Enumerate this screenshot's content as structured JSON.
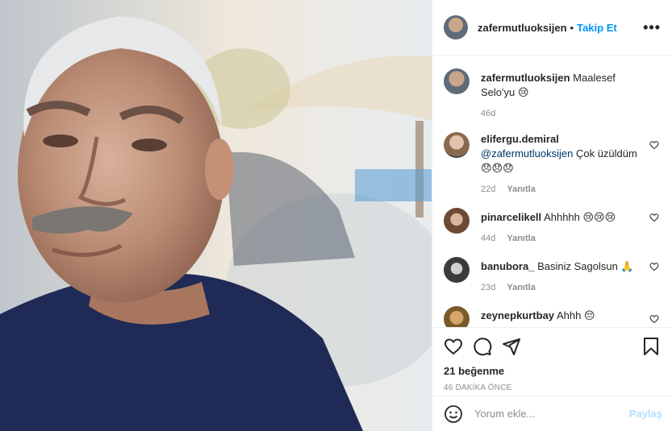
{
  "post": {
    "author": "zafermutluoksijen",
    "separator": "•",
    "follow_label": "Takip Et",
    "more_label": "•••",
    "caption": "Maalesef Selo'yu 😢",
    "caption_age": "46d"
  },
  "comments": [
    {
      "user": "elifergu.demiral",
      "mention": "@zafermutluoksijen",
      "text": " Çok üzüldüm 😞😞😞",
      "age": "22d",
      "reply_label": "Yanıtla"
    },
    {
      "user": "pinarcelikell",
      "mention": "",
      "text": "Ahhhhh 😢😢😢",
      "age": "44d",
      "reply_label": "Yanıtla"
    },
    {
      "user": "banubora_",
      "mention": "",
      "text": "Basiniz Sagolsun 🙏",
      "age": "23d",
      "reply_label": "Yanıtla"
    },
    {
      "user": "zeynepkurtbay",
      "mention": "",
      "text": "Ahhh 😔",
      "age": "",
      "reply_label": ""
    }
  ],
  "stats": {
    "likes": "21 beğenme",
    "time_ago": "46 DAKİKA ÖNCE"
  },
  "composer": {
    "placeholder": "Yorum ekle...",
    "share_label": "Paylaş"
  },
  "colors": {
    "accent": "#0095f6",
    "share_disabled": "#b2dffc",
    "muted": "#8e8e8e"
  },
  "icons": [
    "heart-icon",
    "comment-icon",
    "share-icon",
    "bookmark-icon",
    "emoji-icon"
  ]
}
